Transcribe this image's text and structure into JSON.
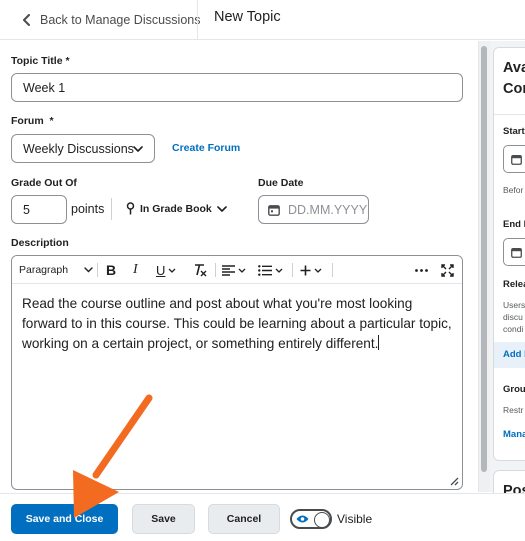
{
  "header": {
    "back_label": "Back to Manage Discussions",
    "title": "New Topic"
  },
  "form": {
    "topic_title_label": "Topic Title",
    "topic_title_required": "*",
    "topic_title_value": "Week 1",
    "forum_label": "Forum",
    "forum_required": "*",
    "forum_value": "Weekly Discussions",
    "create_forum_link": "Create Forum",
    "grade_out_of_label": "Grade Out Of",
    "grade_value": "5",
    "points_label": "points",
    "grade_book_label": "In Grade Book",
    "due_date_label": "Due Date",
    "due_date_placeholder": "DD.MM.YYYY",
    "description_label": "Description"
  },
  "editor": {
    "paragraph_style": "Paragraph",
    "body_text": "Read the course outline and post about what you're most looking forward to in this course. This could be learning about a particular topic, working on a certain project, or something entirely different."
  },
  "right_panel": {
    "heading_line1": "Ava",
    "heading_line2": "Con",
    "start_label": "Start",
    "start_note": "Befor",
    "end_label": "End D",
    "release_label": "Relea",
    "release_line1": "Users",
    "release_line2": "discu",
    "release_line3": "condi",
    "add_label": "Add I",
    "groups_label": "Grou",
    "groups_note": "Restr",
    "manage_link": "Mana",
    "post_heading": "Pos"
  },
  "footer": {
    "save_close_label": "Save and Close",
    "save_label": "Save",
    "cancel_label": "Cancel",
    "visible_label": "Visible"
  },
  "colors": {
    "primary": "#006fbf",
    "annotation_arrow": "#f26b21"
  }
}
